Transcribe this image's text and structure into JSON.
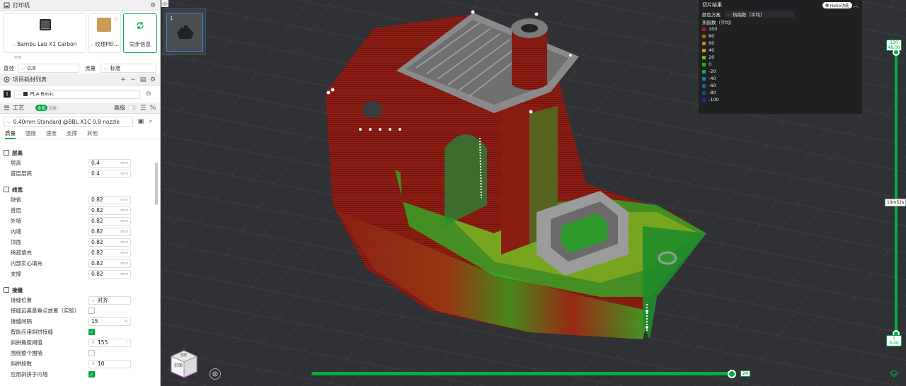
{
  "printer_section": {
    "title": "打印机",
    "printer_name": "Bambu Lab X1 Carbon",
    "plate_name": "纹理PEI...",
    "sync_label": "同步信息",
    "small_label": "喷嘴",
    "diameter_label": "直径",
    "diameter_value": "0.8",
    "flow_label": "流量",
    "flow_value": "标准"
  },
  "filament_section": {
    "title": "项目耗材列表",
    "items": [
      {
        "index": "1",
        "name": "PLA Basic"
      }
    ]
  },
  "process_section": {
    "title": "工艺",
    "toggle_global": "全局",
    "toggle_object": "对象",
    "advanced_label": "高级",
    "preset": "0.40mm Standard @BBL X1C 0.8 nozzle",
    "tabs": [
      "质量",
      "强度",
      "速度",
      "支撑",
      "其他"
    ]
  },
  "groups": {
    "layer_height": {
      "title": "层高",
      "rows": [
        {
          "label": "层高",
          "value": "0.4",
          "unit": "mm"
        },
        {
          "label": "首层层高",
          "value": "0.4",
          "unit": "mm"
        }
      ]
    },
    "line_width": {
      "title": "线宽",
      "rows": [
        {
          "label": "缺省",
          "value": "0.82",
          "unit": "mm"
        },
        {
          "label": "首层",
          "value": "0.82",
          "unit": "mm"
        },
        {
          "label": "外墙",
          "value": "0.82",
          "unit": "mm"
        },
        {
          "label": "内墙",
          "value": "0.82",
          "unit": "mm"
        },
        {
          "label": "顶面",
          "value": "0.82",
          "unit": "mm"
        },
        {
          "label": "稀疏填充",
          "value": "0.82",
          "unit": "mm"
        },
        {
          "label": "内部实心填充",
          "value": "0.82",
          "unit": "mm"
        },
        {
          "label": "支撑",
          "value": "0.82",
          "unit": "mm"
        }
      ]
    },
    "seam": {
      "title": "接缝",
      "seam_position_label": "接缝位置",
      "seam_position_value": "对齐",
      "seam_overhang_label": "接缝远离悬垂点放置（实验）",
      "seam_gap_label": "接缝间隔",
      "seam_gap_value": "15",
      "seam_gap_unit": "%",
      "smart_scarf_label": "智能应用斜拼接缝",
      "scarf_angle_label": "斜拼角度阈值",
      "scarf_angle_value": "155",
      "scarf_angle_unit": "°",
      "scarf_around_label": "围绕整个围墙",
      "scarf_steps_label": "斜拼段数",
      "scarf_steps_value": "10",
      "scarf_inner_label": "应用斜拼于内墙"
    }
  },
  "viewport": {
    "plate_number": "1",
    "legend": {
      "title": "切片结果",
      "helio_label": "Helio功能",
      "scheme_label": "颜色方案",
      "scheme_value": "热指数（平均）",
      "sub_title": "热指数（平均）",
      "items": [
        {
          "label": "100",
          "color": "#b11b12"
        },
        {
          "label": "80",
          "color": "#c2560f"
        },
        {
          "label": "60",
          "color": "#c4870e"
        },
        {
          "label": "40",
          "color": "#b8a90e"
        },
        {
          "label": "20",
          "color": "#7fb514"
        },
        {
          "label": "0",
          "color": "#23b51c"
        },
        {
          "label": "-20",
          "color": "#11a96a"
        },
        {
          "label": "-40",
          "color": "#0b8c8c"
        },
        {
          "label": "-60",
          "color": "#0c6a96"
        },
        {
          "label": "-80",
          "color": "#0d4c98"
        },
        {
          "label": "-100",
          "color": "#0e2f8c"
        }
      ]
    },
    "layer_top": {
      "layer": "120",
      "height": "48.00"
    },
    "layer_bottom": {
      "layer": "1",
      "height": "0.40"
    },
    "print_time": "19m52s",
    "move_value": "24",
    "cube_front": "前面",
    "cube_top": "顶部",
    "accent_color": "#00ae42"
  }
}
